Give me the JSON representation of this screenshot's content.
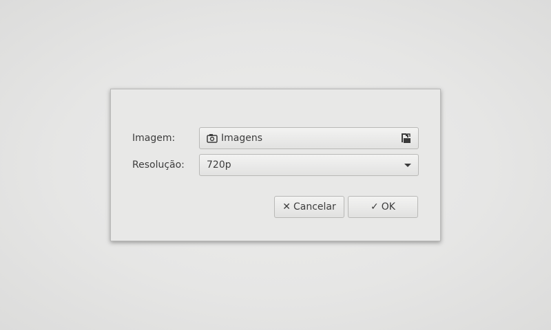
{
  "form": {
    "image_label": "Imagem:",
    "image_value": "Imagens",
    "resolution_label": "Resolução:",
    "resolution_value": "720p"
  },
  "buttons": {
    "cancel_label": "Cancelar",
    "cancel_icon": "✕",
    "ok_label": "OK",
    "ok_icon": "✓"
  },
  "icons": {
    "folder_icon": "camera-folder-icon",
    "open_icon": "document-open-icon",
    "dropdown_icon": "chevron-down-icon"
  }
}
